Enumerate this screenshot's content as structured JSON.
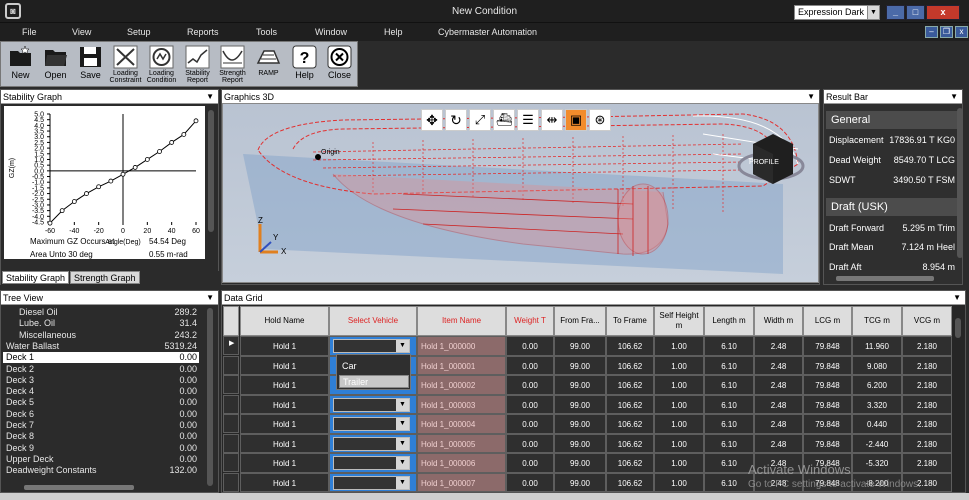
{
  "window": {
    "title": "New Condition",
    "theme_select": "Expression Dark",
    "controls": [
      "_",
      "□",
      "x"
    ]
  },
  "menu": [
    "File",
    "View",
    "Setup",
    "Reports",
    "Tools",
    "Window",
    "Help",
    "Cybermaster Automation"
  ],
  "toolbar": [
    {
      "label": "New",
      "icon": "folder-new-icon"
    },
    {
      "label": "Open",
      "icon": "folder-open-icon"
    },
    {
      "label": "Save",
      "icon": "floppy-disk-icon"
    },
    {
      "label": "Loading Constraint",
      "icon": "loading-constraint-icon"
    },
    {
      "label": "Loading Condition",
      "icon": "loading-condition-icon"
    },
    {
      "label": "Stability Report",
      "icon": "stability-report-icon"
    },
    {
      "label": "Strength Report",
      "icon": "strength-report-icon"
    },
    {
      "label": "RAMP",
      "icon": "ramp-icon"
    },
    {
      "label": "Help",
      "icon": "help-icon"
    },
    {
      "label": "Close",
      "icon": "close-icon"
    }
  ],
  "stability": {
    "title": "Stability Graph",
    "tabs": [
      "Stability Graph",
      "Strength Graph"
    ],
    "max_gz_label": "Maximum GZ Occurs at",
    "max_gz_value": "54.54 Deg",
    "area_label": "Area Unto 30 deg",
    "area_value": "0.55 m-rad"
  },
  "chart_data": {
    "type": "line",
    "xlabel": "Angle(Deg)",
    "ylabel": "GZ(m)",
    "x": [
      -60,
      -50,
      -40,
      -30,
      -20,
      -10,
      0,
      10,
      20,
      30,
      40,
      50,
      60
    ],
    "y": [
      -4.6,
      -3.5,
      -2.7,
      -2.0,
      -1.4,
      -0.9,
      -0.3,
      0.3,
      1.0,
      1.7,
      2.5,
      3.2,
      4.4
    ],
    "xticks": [
      "-60",
      "-40",
      "-20",
      "0",
      "20",
      "40",
      "60"
    ],
    "yticks": [
      "5.0",
      "4.5",
      "4.0",
      "3.5",
      "3.0",
      "2.5",
      "2.0",
      "1.5",
      "1.0",
      "0.5",
      "0.0",
      "-0.5",
      "-1.0",
      "-1.5",
      "-2.0",
      "-2.5",
      "-3.0",
      "-3.5",
      "-4.0",
      "-4.5"
    ],
    "xlim": [
      -60,
      60
    ],
    "ylim": [
      -4.5,
      5.0
    ],
    "grid": false
  },
  "graphics3d": {
    "title": "Graphics 3D",
    "origin_label": "Origin",
    "cube_label": "PROFILE",
    "axes": [
      "Z",
      "Y",
      "X"
    ],
    "icons": [
      "move-icon",
      "rotate-icon",
      "fit-icon",
      "ship-view-icon",
      "report-icon",
      "split-icon",
      "section-icon",
      "hull-icon"
    ]
  },
  "result_bar": {
    "title": "Result Bar",
    "sections": [
      {
        "title": "General",
        "rows": [
          {
            "k": "Displacement",
            "v": "17836.91 T KG0"
          },
          {
            "k": "Dead Weight",
            "v": "8549.70 T LCG"
          },
          {
            "k": "SDWT",
            "v": "3490.50 T FSM"
          }
        ]
      },
      {
        "title": "Draft (USK)",
        "rows": [
          {
            "k": "Draft Forward",
            "v": "5.295 m Trim"
          },
          {
            "k": "Draft Mean",
            "v": "7.124 m Heel"
          },
          {
            "k": "Draft Aft",
            "v": "8.954 m"
          }
        ]
      }
    ]
  },
  "tree": {
    "title": "Tree View",
    "items": [
      {
        "k": "Diesel Oil",
        "v": "289.2",
        "indent": 1
      },
      {
        "k": "Lube. Oil",
        "v": "31.4",
        "indent": 1
      },
      {
        "k": "Miscellaneous",
        "v": "243.2",
        "indent": 1
      },
      {
        "k": "Water Ballast",
        "v": "5319.24",
        "indent": 0
      },
      {
        "k": "Deck 1",
        "v": "0.00",
        "indent": 0,
        "selected": true
      },
      {
        "k": "Deck 2",
        "v": "0.00",
        "indent": 0
      },
      {
        "k": "Deck 3",
        "v": "0.00",
        "indent": 0
      },
      {
        "k": "Deck 4",
        "v": "0.00",
        "indent": 0
      },
      {
        "k": "Deck 5",
        "v": "0.00",
        "indent": 0
      },
      {
        "k": "Deck 6",
        "v": "0.00",
        "indent": 0
      },
      {
        "k": "Deck 7",
        "v": "0.00",
        "indent": 0
      },
      {
        "k": "Deck 8",
        "v": "0.00",
        "indent": 0
      },
      {
        "k": "Deck 9",
        "v": "0.00",
        "indent": 0
      },
      {
        "k": "Upper Deck",
        "v": "0.00",
        "indent": 0
      },
      {
        "k": "Deadweight Constants",
        "v": "132.00",
        "indent": 0
      }
    ]
  },
  "grid": {
    "title": "Data Grid",
    "headers": [
      "Hold Name",
      "Select Vehicle",
      "Item Name",
      "Weight T",
      "From Fra...",
      "To Frame",
      "Self Height m",
      "Length m",
      "Width m",
      "LCG m",
      "TCG m",
      "VCG m"
    ],
    "rows": [
      [
        "Hold 1",
        "",
        "Hold 1_000000",
        "0.00",
        "99.00",
        "106.62",
        "1.00",
        "6.10",
        "2.48",
        "79.848",
        "11.960",
        "2.180"
      ],
      [
        "Hold 1",
        "",
        "Hold 1_000001",
        "0.00",
        "99.00",
        "106.62",
        "1.00",
        "6.10",
        "2.48",
        "79.848",
        "9.080",
        "2.180"
      ],
      [
        "Hold 1",
        "",
        "Hold 1_000002",
        "0.00",
        "99.00",
        "106.62",
        "1.00",
        "6.10",
        "2.48",
        "79.848",
        "6.200",
        "2.180"
      ],
      [
        "Hold 1",
        "",
        "Hold 1_000003",
        "0.00",
        "99.00",
        "106.62",
        "1.00",
        "6.10",
        "2.48",
        "79.848",
        "3.320",
        "2.180"
      ],
      [
        "Hold 1",
        "",
        "Hold 1_000004",
        "0.00",
        "99.00",
        "106.62",
        "1.00",
        "6.10",
        "2.48",
        "79.848",
        "0.440",
        "2.180"
      ],
      [
        "Hold 1",
        "",
        "Hold 1_000005",
        "0.00",
        "99.00",
        "106.62",
        "1.00",
        "6.10",
        "2.48",
        "79.848",
        "-2.440",
        "2.180"
      ],
      [
        "Hold 1",
        "",
        "Hold 1_000006",
        "0.00",
        "99.00",
        "106.62",
        "1.00",
        "6.10",
        "2.48",
        "79.848",
        "-5.320",
        "2.180"
      ],
      [
        "Hold 1",
        "",
        "Hold 1_000007",
        "0.00",
        "99.00",
        "106.62",
        "1.00",
        "6.10",
        "2.48",
        "79.848",
        "-8.200",
        "2.180"
      ]
    ],
    "dropdown_options": [
      "Car",
      "Trailer"
    ]
  },
  "watermark": {
    "line1": "Activate Windows",
    "line2": "Go to PC settings to activate Windows."
  }
}
